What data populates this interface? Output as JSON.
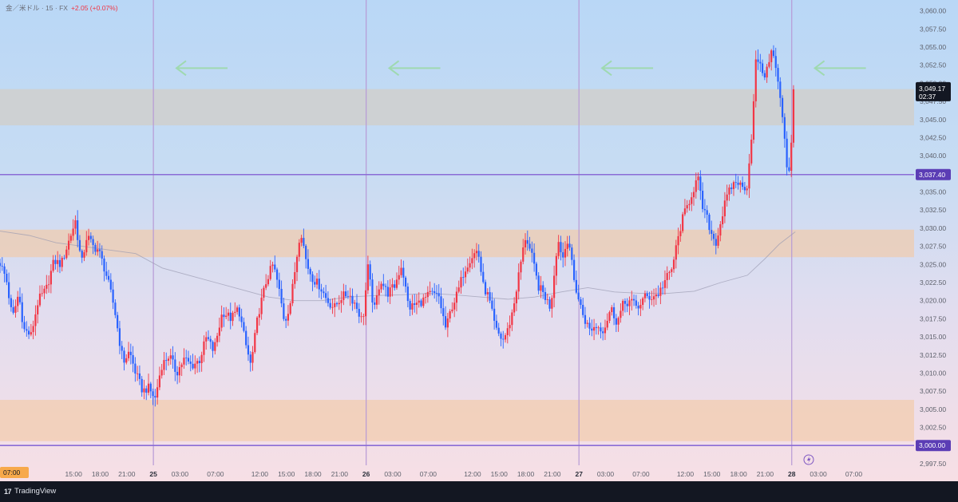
{
  "header": {
    "symbol": "金／米ドル · 15 · FX",
    "change": "+2.05 (+0.07%)"
  },
  "footer": {
    "logo_glyph": "17",
    "brand": "TradingView"
  },
  "colors": {
    "up": "#f23645",
    "down": "#2962ff",
    "gray_zone": "#cfcfcf",
    "orange_zone": "#f3c9a6",
    "level_line": "#8a6cd6",
    "session_line": "#b79ad6",
    "arrow": "#9fd9b0",
    "ma_line": "#9a9ab0",
    "current_price_tag": "#131722",
    "level_tag": "#5b3db5"
  },
  "chart_data": {
    "type": "candlestick",
    "symbol": "金／米ドル",
    "interval": "15",
    "y_ticks": [
      "3,060.00",
      "3,057.50",
      "3,055.00",
      "3,052.50",
      "3,050.00",
      "3,047.50",
      "3,045.00",
      "3,042.50",
      "3,040.00",
      "3,037.50",
      "3,035.00",
      "3,032.50",
      "3,030.00",
      "3,027.50",
      "3,025.00",
      "3,022.50",
      "3,020.00",
      "3,017.50",
      "3,015.00",
      "3,012.50",
      "3,010.00",
      "3,007.50",
      "3,005.00",
      "3,002.50",
      "3,000.00",
      "2,997.50"
    ],
    "y_tick_values": [
      3060,
      3057.5,
      3055,
      3052.5,
      3050,
      3047.5,
      3045,
      3042.5,
      3040,
      3037.5,
      3035,
      3032.5,
      3030,
      3027.5,
      3025,
      3022.5,
      3020,
      3017.5,
      3015,
      3012.5,
      3010,
      3007.5,
      3005,
      3002.5,
      3000,
      2997.5
    ],
    "ylim": [
      2996.5,
      3061.5
    ],
    "x_ticks": [
      {
        "label": "07:00",
        "t": -3.0,
        "highlight": true
      },
      {
        "label": "15:00",
        "t": 4
      },
      {
        "label": "18:00",
        "t": 7
      },
      {
        "label": "21:00",
        "t": 10
      },
      {
        "label": "25",
        "t": 13,
        "day": true
      },
      {
        "label": "03:00",
        "t": 16
      },
      {
        "label": "07:00",
        "t": 20
      },
      {
        "label": "12:00",
        "t": 25
      },
      {
        "label": "15:00",
        "t": 28
      },
      {
        "label": "18:00",
        "t": 31
      },
      {
        "label": "21:00",
        "t": 34
      },
      {
        "label": "26",
        "t": 37,
        "day": true
      },
      {
        "label": "03:00",
        "t": 40
      },
      {
        "label": "07:00",
        "t": 44
      },
      {
        "label": "12:00",
        "t": 49
      },
      {
        "label": "15:00",
        "t": 52
      },
      {
        "label": "18:00",
        "t": 55
      },
      {
        "label": "21:00",
        "t": 58
      },
      {
        "label": "27",
        "t": 61,
        "day": true
      },
      {
        "label": "03:00",
        "t": 64
      },
      {
        "label": "07:00",
        "t": 68
      },
      {
        "label": "12:00",
        "t": 73
      },
      {
        "label": "15:00",
        "t": 76
      },
      {
        "label": "18:00",
        "t": 79
      },
      {
        "label": "21:00",
        "t": 82
      },
      {
        "label": "28",
        "t": 85,
        "day": true
      },
      {
        "label": "03:00",
        "t": 88
      },
      {
        "label": "07:00",
        "t": 92
      }
    ],
    "partial_x_label": "2:00",
    "xlim": [
      -4.3,
      98.8
    ],
    "session_lines_t": [
      13,
      37,
      61,
      85
    ],
    "arrows": [
      {
        "t": 15.6,
        "price": 3052.1
      },
      {
        "t": 39.6,
        "price": 3052.1
      },
      {
        "t": 63.6,
        "price": 3052.1
      },
      {
        "t": 87.6,
        "price": 3052.1
      }
    ],
    "zones": [
      {
        "name": "supply zone",
        "from": 3044.2,
        "to": 3049.2,
        "color": "gray"
      },
      {
        "name": "middle zone",
        "from": 3026.0,
        "to": 3029.8,
        "color": "orange"
      },
      {
        "name": "demand zone",
        "from": 3000.6,
        "to": 3006.3,
        "color": "orange"
      }
    ],
    "levels": [
      {
        "value": 3037.4,
        "label": "3,037.40"
      },
      {
        "value": 3000.0,
        "label": "3,000.00"
      }
    ],
    "current_price": {
      "label": "3,049.17",
      "countdown": "02:37",
      "value": 3049.17
    },
    "series_anchors": [
      [
        -4.3,
        3025.2
      ],
      [
        -3.6,
        3023.0
      ],
      [
        -2.9,
        3017.5
      ],
      [
        -2.2,
        3021.0
      ],
      [
        -1.6,
        3016.0
      ],
      [
        -0.8,
        3015.2
      ],
      [
        0.0,
        3020.0
      ],
      [
        0.9,
        3021.5
      ],
      [
        1.8,
        3025.5
      ],
      [
        2.6,
        3025.0
      ],
      [
        3.4,
        3028.0
      ],
      [
        4.2,
        3031.0
      ],
      [
        4.9,
        3025.0
      ],
      [
        5.5,
        3029.0
      ],
      [
        6.2,
        3027.5
      ],
      [
        6.8,
        3027.0
      ],
      [
        7.6,
        3024.0
      ],
      [
        8.6,
        3019.0
      ],
      [
        9.1,
        3015.0
      ],
      [
        9.6,
        3011.5
      ],
      [
        10.3,
        3013.0
      ],
      [
        11.0,
        3010.0
      ],
      [
        11.8,
        3007.5
      ],
      [
        12.4,
        3008.0
      ],
      [
        13.2,
        3006.5
      ],
      [
        13.9,
        3011.0
      ],
      [
        14.8,
        3012.5
      ],
      [
        15.6,
        3010.0
      ],
      [
        16.5,
        3012.0
      ],
      [
        17.3,
        3011.0
      ],
      [
        18.2,
        3011.8
      ],
      [
        19.0,
        3015.0
      ],
      [
        19.8,
        3013.0
      ],
      [
        20.8,
        3018.5
      ],
      [
        21.8,
        3017.5
      ],
      [
        22.6,
        3019.0
      ],
      [
        23.4,
        3014.0
      ],
      [
        24.0,
        3011.0
      ],
      [
        24.8,
        3018.0
      ],
      [
        25.8,
        3023.0
      ],
      [
        26.5,
        3025.0
      ],
      [
        27.1,
        3022.0
      ],
      [
        27.8,
        3017.0
      ],
      [
        28.5,
        3020.0
      ],
      [
        29.0,
        3024.5
      ],
      [
        29.6,
        3030.0
      ],
      [
        30.3,
        3025.0
      ],
      [
        31.0,
        3023.0
      ],
      [
        31.8,
        3022.0
      ],
      [
        32.6,
        3020.0
      ],
      [
        33.4,
        3019.0
      ],
      [
        34.2,
        3020.5
      ],
      [
        35.0,
        3021.0
      ],
      [
        35.8,
        3019.5
      ],
      [
        36.6,
        3017.0
      ],
      [
        37.2,
        3024.5
      ],
      [
        37.9,
        3018.5
      ],
      [
        38.6,
        3023.0
      ],
      [
        39.4,
        3021.0
      ],
      [
        40.2,
        3022.0
      ],
      [
        41.0,
        3025.0
      ],
      [
        41.8,
        3019.0
      ],
      [
        42.6,
        3019.5
      ],
      [
        43.4,
        3020.0
      ],
      [
        44.3,
        3021.0
      ],
      [
        45.2,
        3020.5
      ],
      [
        46.0,
        3016.0
      ],
      [
        46.6,
        3019.0
      ],
      [
        47.3,
        3021.0
      ],
      [
        48.0,
        3024.0
      ],
      [
        48.8,
        3026.0
      ],
      [
        49.6,
        3027.0
      ],
      [
        50.2,
        3022.0
      ],
      [
        50.8,
        3020.5
      ],
      [
        51.6,
        3016.0
      ],
      [
        52.4,
        3014.5
      ],
      [
        53.0,
        3016.0
      ],
      [
        53.6,
        3019.0
      ],
      [
        54.4,
        3025.0
      ],
      [
        55.0,
        3029.0
      ],
      [
        55.7,
        3026.0
      ],
      [
        56.4,
        3022.0
      ],
      [
        57.0,
        3021.0
      ],
      [
        57.8,
        3019.0
      ],
      [
        58.6,
        3028.5
      ],
      [
        59.2,
        3026.0
      ],
      [
        59.8,
        3029.0
      ],
      [
        60.4,
        3023.0
      ],
      [
        61.0,
        3020.0
      ],
      [
        61.6,
        3017.5
      ],
      [
        62.2,
        3016.0
      ],
      [
        63.0,
        3016.5
      ],
      [
        63.8,
        3016.0
      ],
      [
        64.6,
        3019.0
      ],
      [
        65.3,
        3017.0
      ],
      [
        66.0,
        3019.5
      ],
      [
        66.8,
        3020.0
      ],
      [
        67.6,
        3019.0
      ],
      [
        68.4,
        3020.5
      ],
      [
        69.2,
        3020.5
      ],
      [
        70.0,
        3021.0
      ],
      [
        70.8,
        3023.0
      ],
      [
        71.4,
        3024.0
      ],
      [
        72.0,
        3027.5
      ],
      [
        72.6,
        3031.0
      ],
      [
        73.2,
        3033.0
      ],
      [
        73.8,
        3035.0
      ],
      [
        74.4,
        3037.0
      ],
      [
        74.9,
        3033.0
      ],
      [
        75.4,
        3031.5
      ],
      [
        76.0,
        3029.0
      ],
      [
        76.5,
        3028.0
      ],
      [
        77.0,
        3031.0
      ],
      [
        77.6,
        3034.0
      ],
      [
        78.3,
        3036.0
      ],
      [
        78.9,
        3036.5
      ],
      [
        79.4,
        3035.5
      ],
      [
        80.0,
        3036.0
      ],
      [
        80.6,
        3045.0
      ],
      [
        81.0,
        3054.0
      ],
      [
        81.5,
        3052.0
      ],
      [
        82.1,
        3051.0
      ],
      [
        82.7,
        3055.0
      ],
      [
        83.2,
        3052.0
      ],
      [
        83.7,
        3048.0
      ],
      [
        84.2,
        3042.0
      ],
      [
        84.6,
        3036.5
      ],
      [
        85.0,
        3043.0
      ],
      [
        85.4,
        3049.17
      ]
    ],
    "ma_points": [
      [
        -4.3,
        3029.6
      ],
      [
        -1.0,
        3029.0
      ],
      [
        2.0,
        3028.0
      ],
      [
        5.0,
        3027.5
      ],
      [
        8.0,
        3027.0
      ],
      [
        11.0,
        3026.5
      ],
      [
        14.0,
        3024.5
      ],
      [
        17.0,
        3023.5
      ],
      [
        20.0,
        3022.5
      ],
      [
        23.0,
        3021.5
      ],
      [
        26.0,
        3020.5
      ],
      [
        29.0,
        3020.0
      ],
      [
        32.0,
        3020.0
      ],
      [
        35.0,
        3020.5
      ],
      [
        38.0,
        3020.7
      ],
      [
        41.0,
        3020.8
      ],
      [
        44.0,
        3021.0
      ],
      [
        47.0,
        3020.8
      ],
      [
        50.0,
        3020.5
      ],
      [
        53.0,
        3020.2
      ],
      [
        56.0,
        3020.5
      ],
      [
        59.0,
        3021.2
      ],
      [
        62.0,
        3021.8
      ],
      [
        65.0,
        3021.2
      ],
      [
        68.0,
        3021.0
      ],
      [
        71.0,
        3021.0
      ],
      [
        74.0,
        3021.3
      ],
      [
        77.0,
        3022.5
      ],
      [
        80.0,
        3023.5
      ],
      [
        82.0,
        3025.8
      ],
      [
        83.6,
        3027.8
      ],
      [
        85.4,
        3029.5
      ]
    ]
  }
}
